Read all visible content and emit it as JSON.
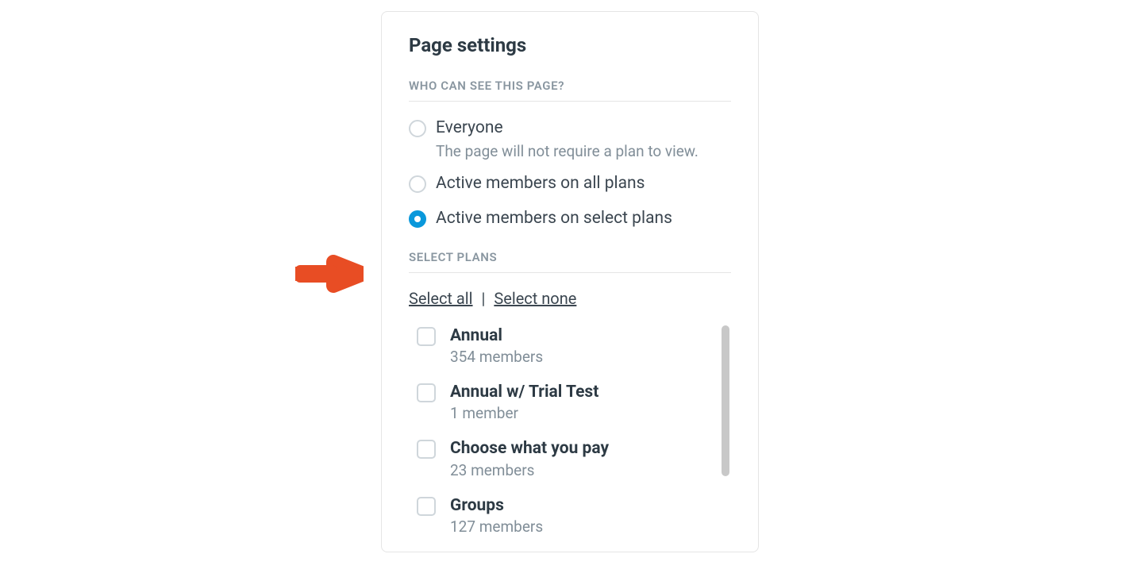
{
  "panel": {
    "title": "Page settings"
  },
  "visibility": {
    "section_label": "WHO CAN SEE THIS PAGE?",
    "options": [
      {
        "label": "Everyone",
        "sublabel": "The page will not require a plan to view.",
        "checked": false
      },
      {
        "label": "Active members on all plans",
        "sublabel": "",
        "checked": false
      },
      {
        "label": "Active members on select plans",
        "sublabel": "",
        "checked": true
      }
    ]
  },
  "plans": {
    "section_label": "SELECT PLANS",
    "select_all_label": "Select all",
    "separator": " | ",
    "select_none_label": "Select none",
    "items": [
      {
        "name": "Annual",
        "members": "354 members",
        "checked": false
      },
      {
        "name": "Annual w/ Trial Test",
        "members": "1 member",
        "checked": false
      },
      {
        "name": "Choose what you pay",
        "members": "23 members",
        "checked": false
      },
      {
        "name": "Groups",
        "members": "127 members",
        "checked": false
      }
    ]
  }
}
